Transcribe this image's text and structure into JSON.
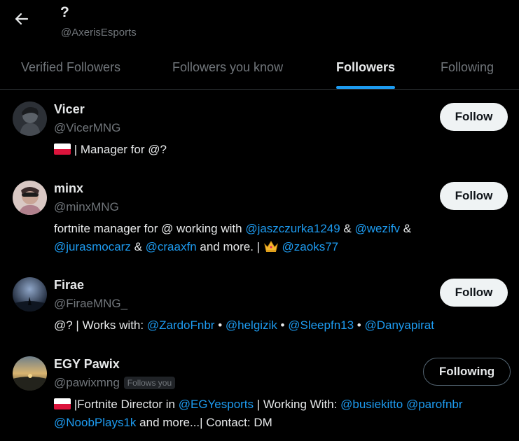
{
  "header": {
    "title": "?",
    "handle": "@AxerisEsports"
  },
  "tabs": [
    {
      "label": "Verified Followers",
      "active": false
    },
    {
      "label": "Followers you know",
      "active": false
    },
    {
      "label": "Followers",
      "active": true
    },
    {
      "label": "Following",
      "active": false
    }
  ],
  "colors": {
    "accent": "#1d9bf0",
    "background": "#000000",
    "text": "#e7e9ea",
    "muted": "#71767b"
  },
  "users": [
    {
      "name": "Vicer",
      "handle": "@VicerMNG",
      "button": "Follow",
      "bio": {
        "flag": "poland-flag",
        "text": " | Manager for @?"
      }
    },
    {
      "name": "minx",
      "handle": "@minxMNG",
      "button": "Follow",
      "bio": {
        "t1": "fortnite manager for @ working with ",
        "m1": "@jaszczurka1249",
        "t2": " & ",
        "m2": "@wezifv",
        "t3": " & ",
        "m3": "@jurasmocarz",
        "t4": " & ",
        "m4": "@craaxfn",
        "t5": " and more. | ",
        "icon": "crown-icon",
        "m5": "@zaoks77"
      }
    },
    {
      "name": "Firae",
      "handle": "@FiraeMNG_",
      "button": "Follow",
      "bio": {
        "t1": "@? | Works with: ",
        "m1": "@ZardoFnbr",
        "s1": " • ",
        "m2": "@helgizik",
        "s2": " • ",
        "m3": "@Sleepfn13",
        "s3": " • ",
        "m4": "@Danyapirat"
      }
    },
    {
      "name": "EGY Pawix",
      "handle": "@pawixmng",
      "follows_you": "Follows you",
      "button": "Following",
      "bio": {
        "flag": "poland-flag",
        "t1": " |Fortnite Director in ",
        "m1": "@EGYesports",
        "t2": " | Working With: ",
        "m2": "@busiekitto",
        "t3": " ",
        "m3": "@parofnbr",
        "m4": "@NoobPlays1k",
        "t4": " and more...| Contact: DM"
      }
    }
  ]
}
